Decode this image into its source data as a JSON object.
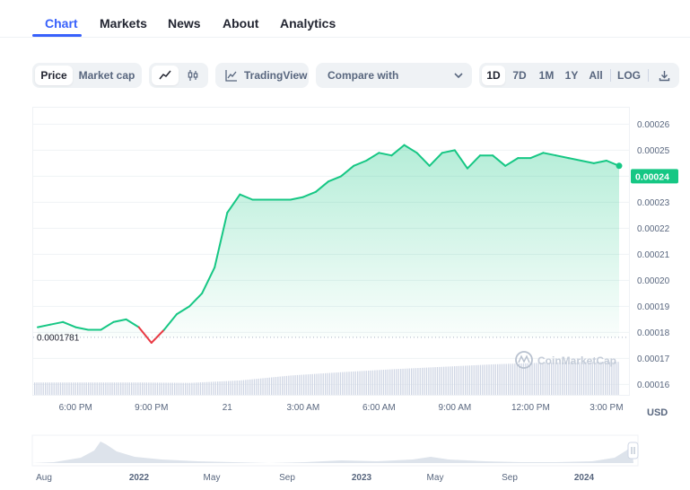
{
  "tabs": [
    "Chart",
    "Markets",
    "News",
    "About",
    "Analytics"
  ],
  "toolbar": {
    "price_label": "Price",
    "market_cap_label": "Market cap",
    "tradingview_label": "TradingView",
    "compare_label": "Compare with",
    "ranges": [
      "1D",
      "7D",
      "1M",
      "1Y",
      "All"
    ],
    "log_label": "LOG"
  },
  "currency_label": "USD",
  "watermark": "CoinMarketCap",
  "chart_data": {
    "type": "area",
    "x_ticks": [
      "6:00 PM",
      "9:00 PM",
      "21",
      "3:00 AM",
      "6:00 AM",
      "9:00 AM",
      "12:00 PM",
      "3:00 PM"
    ],
    "y_ticks": [
      "0.00016",
      "0.00017",
      "0.00018",
      "0.00019",
      "0.00020",
      "0.00021",
      "0.00022",
      "0.00023",
      "0.00024",
      "0.00025",
      "0.00026"
    ],
    "ylim": [
      0.000156,
      0.000266
    ],
    "baseline_value": 0.0001781,
    "baseline_label": "0.0001781",
    "current_price": 0.00024,
    "current_price_label": "0.00024",
    "x": [
      0,
      0.5,
      1,
      1.5,
      2,
      2.5,
      3,
      3.5,
      4,
      4.5,
      5,
      5.5,
      6,
      6.5,
      7,
      7.5,
      8,
      8.5,
      9,
      9.5,
      10,
      10.5,
      11,
      11.5,
      12,
      12.5,
      13,
      13.5,
      14,
      14.5,
      15,
      15.5,
      16,
      16.5,
      17,
      17.5,
      18,
      18.5,
      19,
      19.5,
      20,
      20.5,
      21,
      21.5,
      22,
      22.5,
      23
    ],
    "values": [
      0.000182,
      0.000183,
      0.000184,
      0.000182,
      0.000181,
      0.000181,
      0.000184,
      0.000185,
      0.000182,
      0.000176,
      0.000181,
      0.000187,
      0.00019,
      0.000195,
      0.000205,
      0.000226,
      0.000233,
      0.000231,
      0.000231,
      0.000231,
      0.000231,
      0.000232,
      0.000234,
      0.000238,
      0.00024,
      0.000244,
      0.000246,
      0.000249,
      0.000248,
      0.000252,
      0.000249,
      0.000244,
      0.000249,
      0.00025,
      0.000243,
      0.000248,
      0.000248,
      0.000244,
      0.000247,
      0.000247,
      0.000249,
      0.000248,
      0.000247,
      0.000246,
      0.000245,
      0.000246,
      0.000244
    ],
    "volume_x": [
      0,
      2,
      4,
      6,
      8,
      10,
      12,
      14,
      16,
      18,
      20,
      22,
      23
    ],
    "volume": [
      0.3,
      0.3,
      0.3,
      0.29,
      0.35,
      0.47,
      0.55,
      0.62,
      0.68,
      0.74,
      0.78,
      0.8,
      0.8
    ],
    "navigator_ticks": [
      "Aug",
      "2022",
      "May",
      "Sep",
      "2023",
      "May",
      "Sep",
      "2024"
    ]
  },
  "colors": {
    "accent": "#3861fb",
    "up": "#16c784",
    "down": "#ea3943",
    "text": "#222531",
    "muted": "#58667e"
  }
}
